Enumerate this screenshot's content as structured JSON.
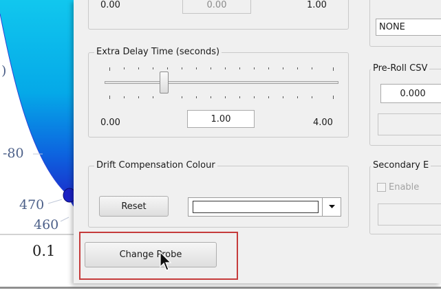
{
  "chart": {
    "tick_labels": [
      "-80",
      "470",
      "460"
    ],
    "x_label": "0.1",
    "partial_label": ")"
  },
  "dialog": {
    "top_row": {
      "min": "0.00",
      "value": "0.00",
      "max": "1.00"
    },
    "delay": {
      "group_label": "Extra Delay Time (seconds)",
      "min": "0.00",
      "value": "1.00",
      "max": "4.00",
      "slider_level": 0.25
    },
    "drift": {
      "group_label": "Drift Compensation Colour",
      "reset_label": "Reset"
    },
    "change_probe_label": "Change Probe",
    "right": {
      "none_value": "NONE",
      "preroll_label": "Pre-Roll CSV",
      "preroll_value": "0.000",
      "secondary_label": "Secondary E",
      "enable_label": "Enable"
    }
  },
  "colors": {
    "highlight": "#c53a3a",
    "chart_cyan": "#00d5f0",
    "chart_blue": "#1f2fd9"
  }
}
